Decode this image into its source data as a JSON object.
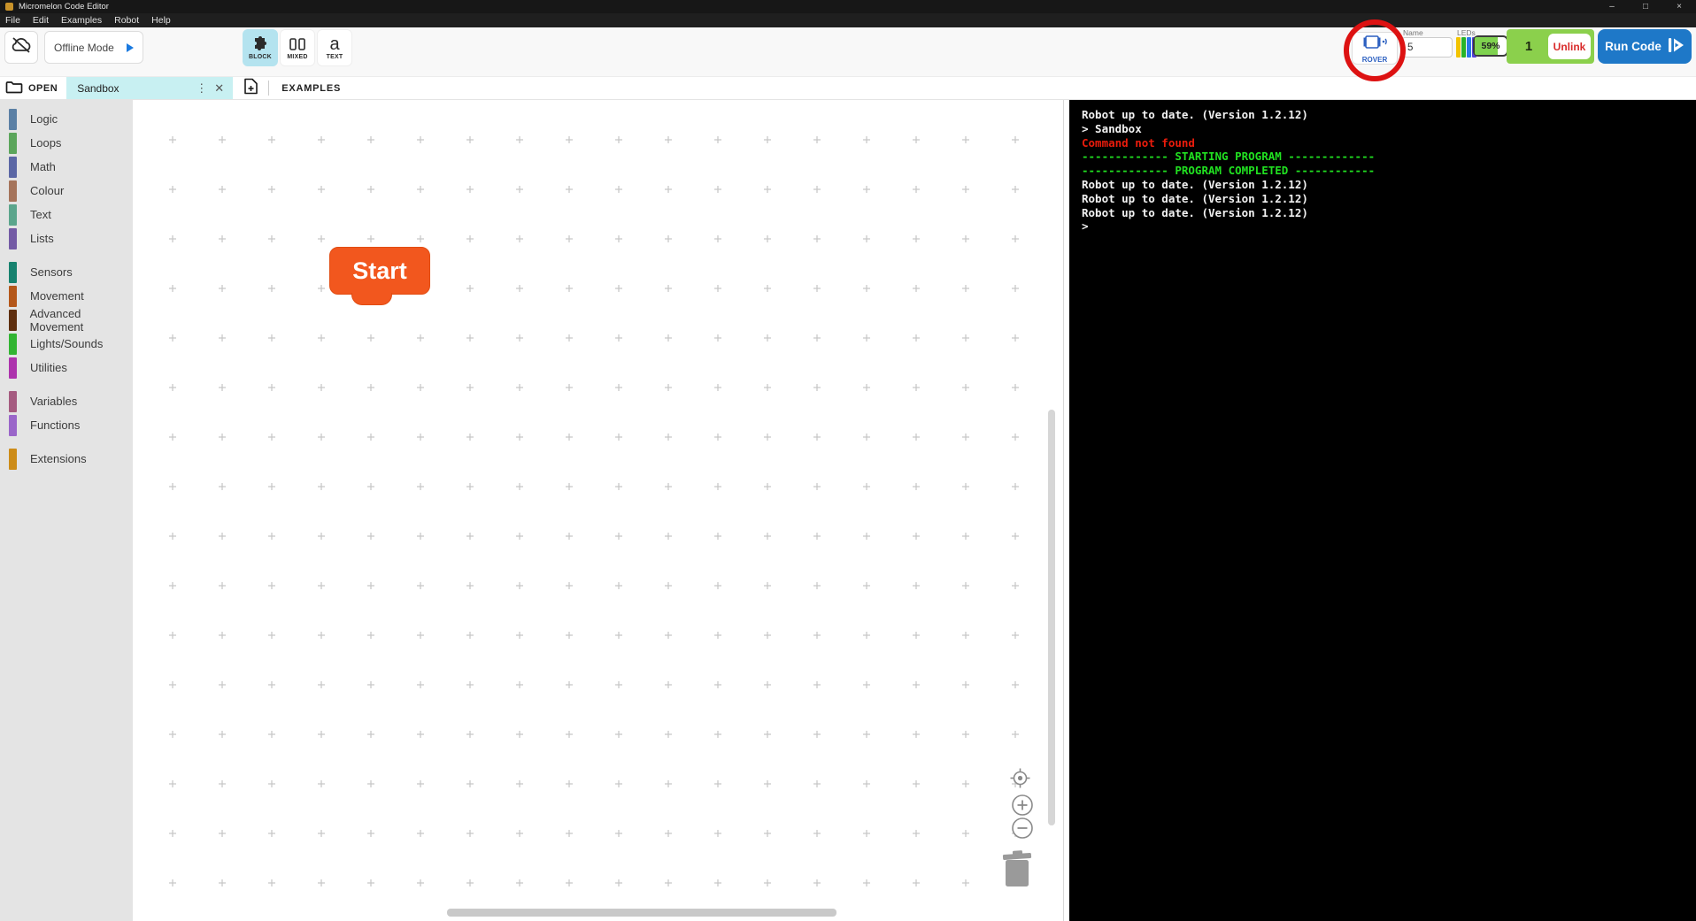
{
  "window": {
    "title": "Micromelon Code Editor",
    "controls": [
      {
        "name": "minimize",
        "glyph": "–"
      },
      {
        "name": "maximize",
        "glyph": "□"
      },
      {
        "name": "close",
        "glyph": "×"
      }
    ]
  },
  "menu": {
    "items": [
      "File",
      "Edit",
      "Examples",
      "Robot",
      "Help"
    ]
  },
  "toolbar": {
    "offline_mode_label": "Offline Mode",
    "view_modes": [
      {
        "label": "BLOCK",
        "icon": "puzzle-icon",
        "selected": true
      },
      {
        "label": "MIXED",
        "icon": "split-view-icon",
        "selected": false
      },
      {
        "label": "TEXT",
        "icon": "letter-a-icon",
        "selected": false
      }
    ],
    "connection": {
      "rover_label": "ROVER",
      "name_label": "Name",
      "name_value": "5",
      "leds_label": "LEDs",
      "led_colors": [
        "#f2c300",
        "#28b428",
        "#2979e8",
        "#5440d8"
      ],
      "battery_percent": "59%",
      "battery_fill_color": "#7fd24f",
      "group_number": "1",
      "group_panel_color": "#8bd04c",
      "unlink_label": "Unlink",
      "run_code_label": "Run Code",
      "run_code_color": "#1e78c8"
    }
  },
  "tabs": {
    "open_label": "OPEN",
    "active_tab": "Sandbox",
    "examples_label": "EXAMPLES"
  },
  "sidebar": {
    "categories": [
      {
        "label": "Logic",
        "color": "#5b80a5"
      },
      {
        "label": "Loops",
        "color": "#5ba55b"
      },
      {
        "label": "Math",
        "color": "#5b67a5"
      },
      {
        "label": "Colour",
        "color": "#a5745b"
      },
      {
        "label": "Text",
        "color": "#5ba58c"
      },
      {
        "label": "Lists",
        "color": "#745ba5"
      },
      {
        "label": "Sensors",
        "color": "#17826f",
        "gap_before": true
      },
      {
        "label": "Movement",
        "color": "#b4571a"
      },
      {
        "label": "Advanced Movement",
        "color": "#5e2e0e"
      },
      {
        "label": "Lights/Sounds",
        "color": "#32b432"
      },
      {
        "label": "Utilities",
        "color": "#ad33ad"
      },
      {
        "label": "Variables",
        "color": "#a55b80",
        "gap_before": true
      },
      {
        "label": "Functions",
        "color": "#9a66c9"
      },
      {
        "label": "Extensions",
        "color": "#cd8c18",
        "gap_before": true
      }
    ]
  },
  "canvas": {
    "start_block_label": "Start",
    "start_block_color": "#f2571e"
  },
  "console": {
    "lines": [
      {
        "text": "Robot up to date. (Version 1.2.12)",
        "type": "info"
      },
      {
        "text": "> Sandbox",
        "type": "info"
      },
      {
        "text": "Command not found",
        "type": "error"
      },
      {
        "text": "------------- STARTING PROGRAM -------------",
        "type": "success"
      },
      {
        "text": "------------- PROGRAM COMPLETED ------------",
        "type": "success"
      },
      {
        "text": "Robot up to date. (Version 1.2.12)",
        "type": "info"
      },
      {
        "text": "Robot up to date. (Version 1.2.12)",
        "type": "info"
      },
      {
        "text": "Robot up to date. (Version 1.2.12)",
        "type": "info"
      },
      {
        "text": ">",
        "type": "info"
      }
    ],
    "text_color": "#f2f2f2",
    "error_color": "#ea1c0c",
    "success_color": "#21e121"
  }
}
